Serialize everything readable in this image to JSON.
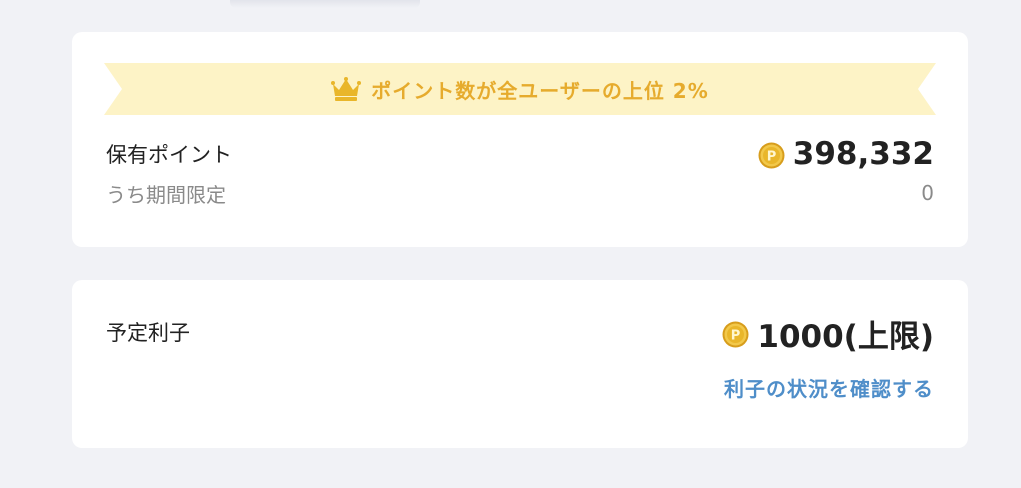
{
  "colors": {
    "background": "#f1f2f6",
    "card": "#ffffff",
    "ribbon": "#fdf3c6",
    "ribbon_text": "#e6ab2d",
    "link": "#4f8ec9",
    "coin": "#e9b62a"
  },
  "banner": {
    "icon": "crown-icon",
    "text": "ポイント数が全ユーザーの上位 2%"
  },
  "points_card": {
    "held_label": "保有ポイント",
    "held_icon": "coin-icon",
    "held_value": "398,332",
    "limited_label": "うち期間限定",
    "limited_value": "0"
  },
  "interest_card": {
    "label": "予定利子",
    "icon": "coin-icon",
    "value": "1000(上限)",
    "link_text": "利子の状況を確認する"
  }
}
